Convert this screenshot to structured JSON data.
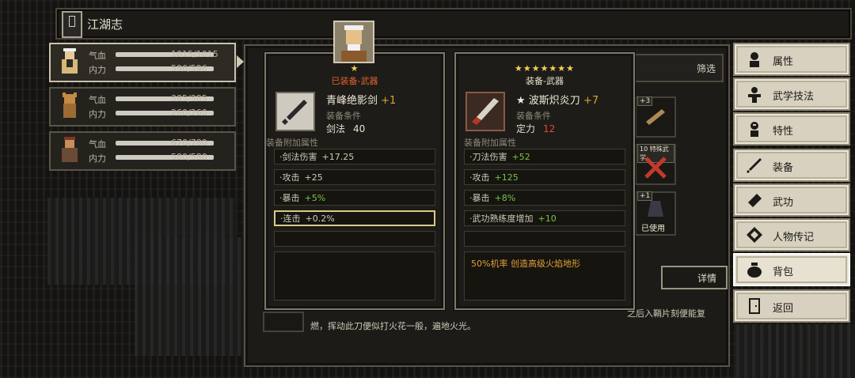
{
  "window": {
    "title": "江湖志"
  },
  "characters": [
    {
      "labels": [
        "气血",
        "内力"
      ],
      "hp": "1015/1015",
      "mp": "596/596"
    },
    {
      "labels": [
        "气血",
        "内力"
      ],
      "hp": "385/385",
      "mp": "260/260"
    },
    {
      "labels": [
        "气血",
        "内力"
      ],
      "hp": "670/780",
      "mp": "580/580"
    }
  ],
  "panel": {
    "filter_label": "筛选",
    "detail_label": "详情",
    "description": "燃，挥动此刀便似打火花一般，遍地火光。",
    "hint": "之后入鞘片刻便能复",
    "slots": {
      "a": "+3",
      "b": "10 特殊武学",
      "c": "+1",
      "used": "已使用"
    }
  },
  "equipped_card": {
    "stars": "★",
    "header": "已装备-武器",
    "name": "青峰绝影剑",
    "plus": "+1",
    "req_label": "装备条件",
    "req_stat": "剑法",
    "req_value": "40",
    "attr_title": "装备附加属性",
    "attrs": [
      {
        "name": "·剑法伤害",
        "value": "+17.25"
      },
      {
        "name": "·攻击",
        "value": "+25"
      },
      {
        "name": "·暴击",
        "value": "+5%"
      },
      {
        "name": "·连击",
        "value": "+0.2%"
      }
    ]
  },
  "compare_card": {
    "stars": "★★★★★★★",
    "header": "装备-武器",
    "name_star": "★",
    "name": "波斯炽炎刀",
    "plus": "+7",
    "req_label": "装备条件",
    "req_stat": "定力",
    "req_value": "12",
    "attr_title": "装备附加属性",
    "attrs": [
      {
        "name": "·刀法伤害",
        "value": "+52"
      },
      {
        "name": "·攻击",
        "value": "+125"
      },
      {
        "name": "·暴击",
        "value": "+8%"
      },
      {
        "name": "·武功熟练度增加",
        "value": "+10"
      }
    ],
    "effect": "50%机率 创造高级火焰地形"
  },
  "menu": [
    {
      "label": "属性",
      "icon": "person-icon"
    },
    {
      "label": "武学技法",
      "icon": "martial-arts-icon"
    },
    {
      "label": "特性",
      "icon": "trait-icon"
    },
    {
      "label": "装备",
      "icon": "sword-icon"
    },
    {
      "label": "武功",
      "icon": "manual-icon"
    },
    {
      "label": "人物传记",
      "icon": "biography-icon"
    },
    {
      "label": "背包",
      "icon": "bag-icon"
    },
    {
      "label": "返回",
      "icon": "door-icon"
    }
  ],
  "colors": {
    "star": "#f2d15c",
    "positive": "#7ac24a",
    "negative": "#e04a3b",
    "upgrade": "#e0a330",
    "effect": "#e2a038",
    "equipped_header": "#e0612e"
  }
}
